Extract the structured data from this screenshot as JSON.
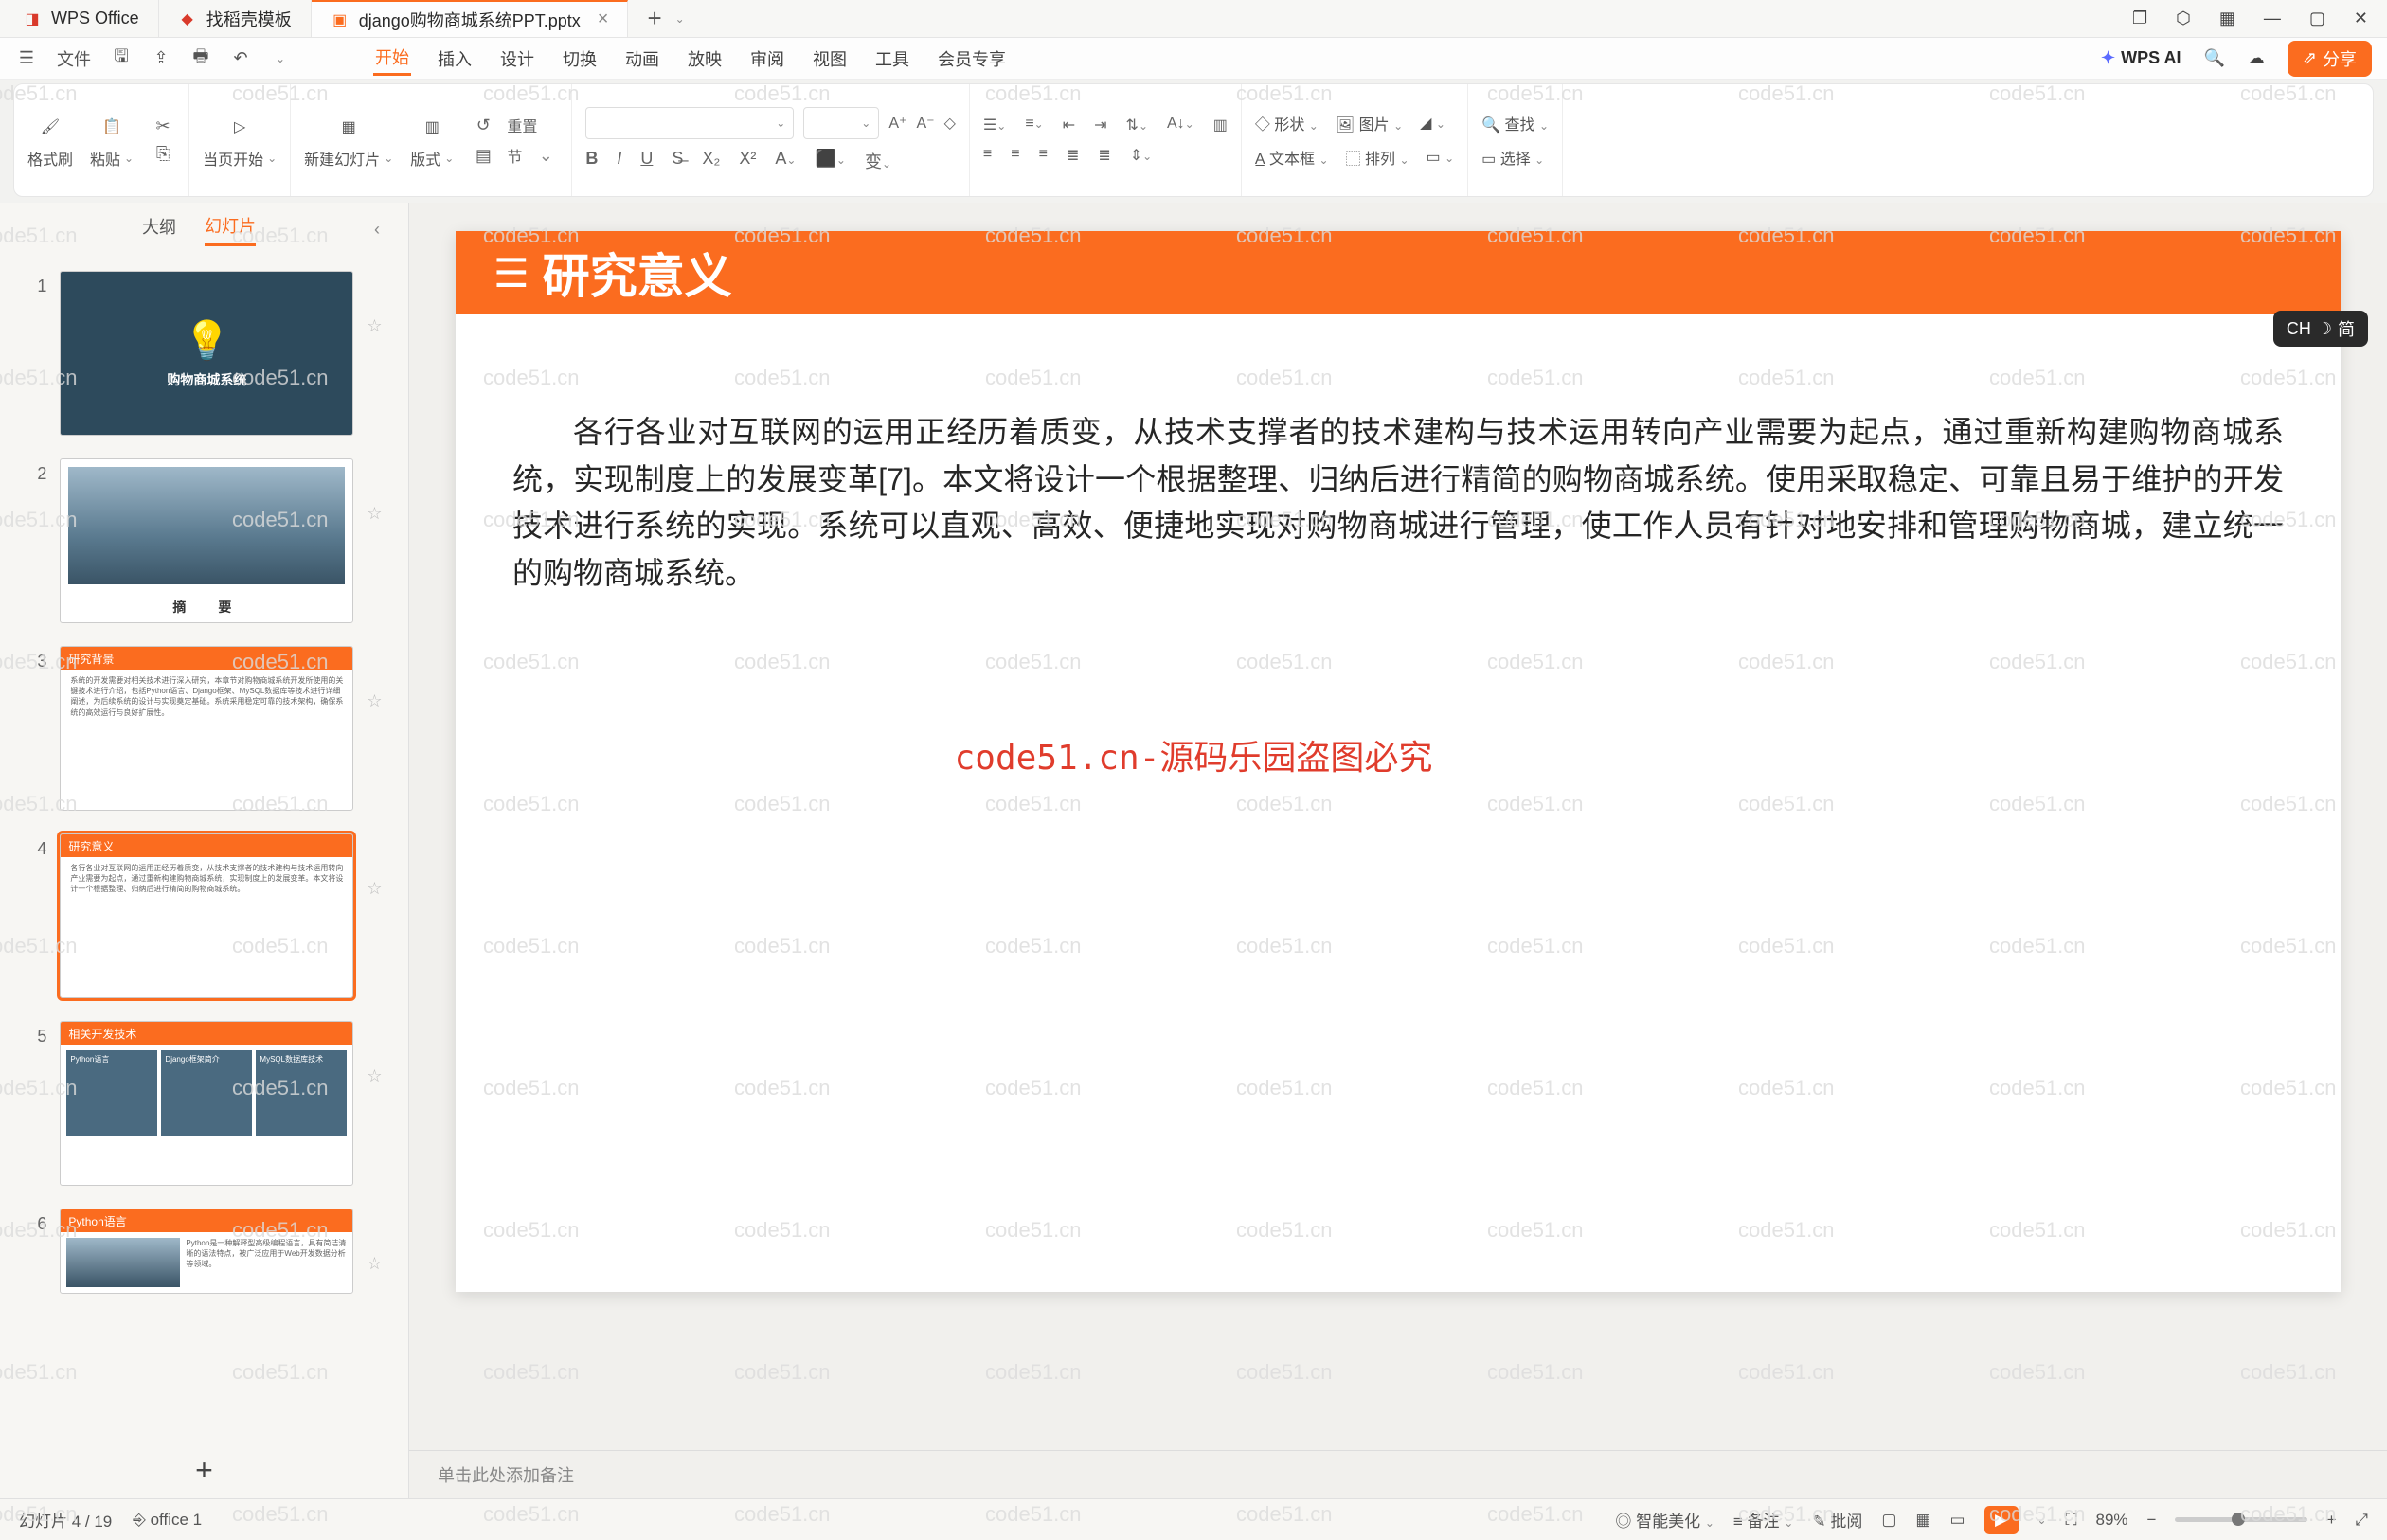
{
  "tabs": {
    "app": "WPS Office",
    "template": "找稻壳模板",
    "doc": "django购物商城系统PPT.pptx"
  },
  "menus": {
    "file": "文件",
    "start": "开始",
    "insert": "插入",
    "design": "设计",
    "transition": "切换",
    "anim": "动画",
    "play": "放映",
    "review": "审阅",
    "view": "视图",
    "tool": "工具",
    "member": "会员专享",
    "ai": "WPS AI",
    "share": "分享"
  },
  "ribbon": {
    "format_brush": "格式刷",
    "paste": "粘贴",
    "from_current": "当页开始",
    "new_slide": "新建幻灯片",
    "layout": "版式",
    "section": "节",
    "reset": "重置",
    "shape": "形状",
    "image": "图片",
    "textbox": "文本框",
    "arrange": "排列",
    "find": "查找",
    "select": "选择"
  },
  "thumb_tabs": {
    "outline": "大纲",
    "slides": "幻灯片"
  },
  "thumbs": [
    {
      "n": "1",
      "title": "购物商城系统"
    },
    {
      "n": "2",
      "caption": "摘　要"
    },
    {
      "n": "3",
      "bar": "研究背景"
    },
    {
      "n": "4",
      "bar": "研究意义"
    },
    {
      "n": "5",
      "bar": "相关开发技术",
      "tiles": [
        "Python语言",
        "Django框架简介",
        "MySQL数据库技术"
      ]
    },
    {
      "n": "6",
      "bar": "Python语言"
    }
  ],
  "slide": {
    "title": "研究意义",
    "body": "各行各业对互联网的运用正经历着质变，从技术支撑者的技术建构与技术运用转向产业需要为起点，通过重新构建购物商城系统，实现制度上的发展变革[7]。本文将设计一个根据整理、归纳后进行精简的购物商城系统。使用采取稳定、可靠且易于维护的开发技术进行系统的实现。系统可以直观、高效、便捷地实现对购物商城进行管理，使工作人员有针对地安排和管理购物商城，建立统一的购物商城系统。"
  },
  "watermark_red": "code51.cn-源码乐园盗图必究",
  "notes_placeholder": "单击此处添加备注",
  "status": {
    "slide_counter": "幻灯片 4 / 19",
    "office": "office 1",
    "beautify": "智能美化",
    "notes": "备注",
    "批阅": "批阅",
    "zoom": "89%"
  },
  "ime": {
    "lang": "CH",
    "mode": "简"
  }
}
